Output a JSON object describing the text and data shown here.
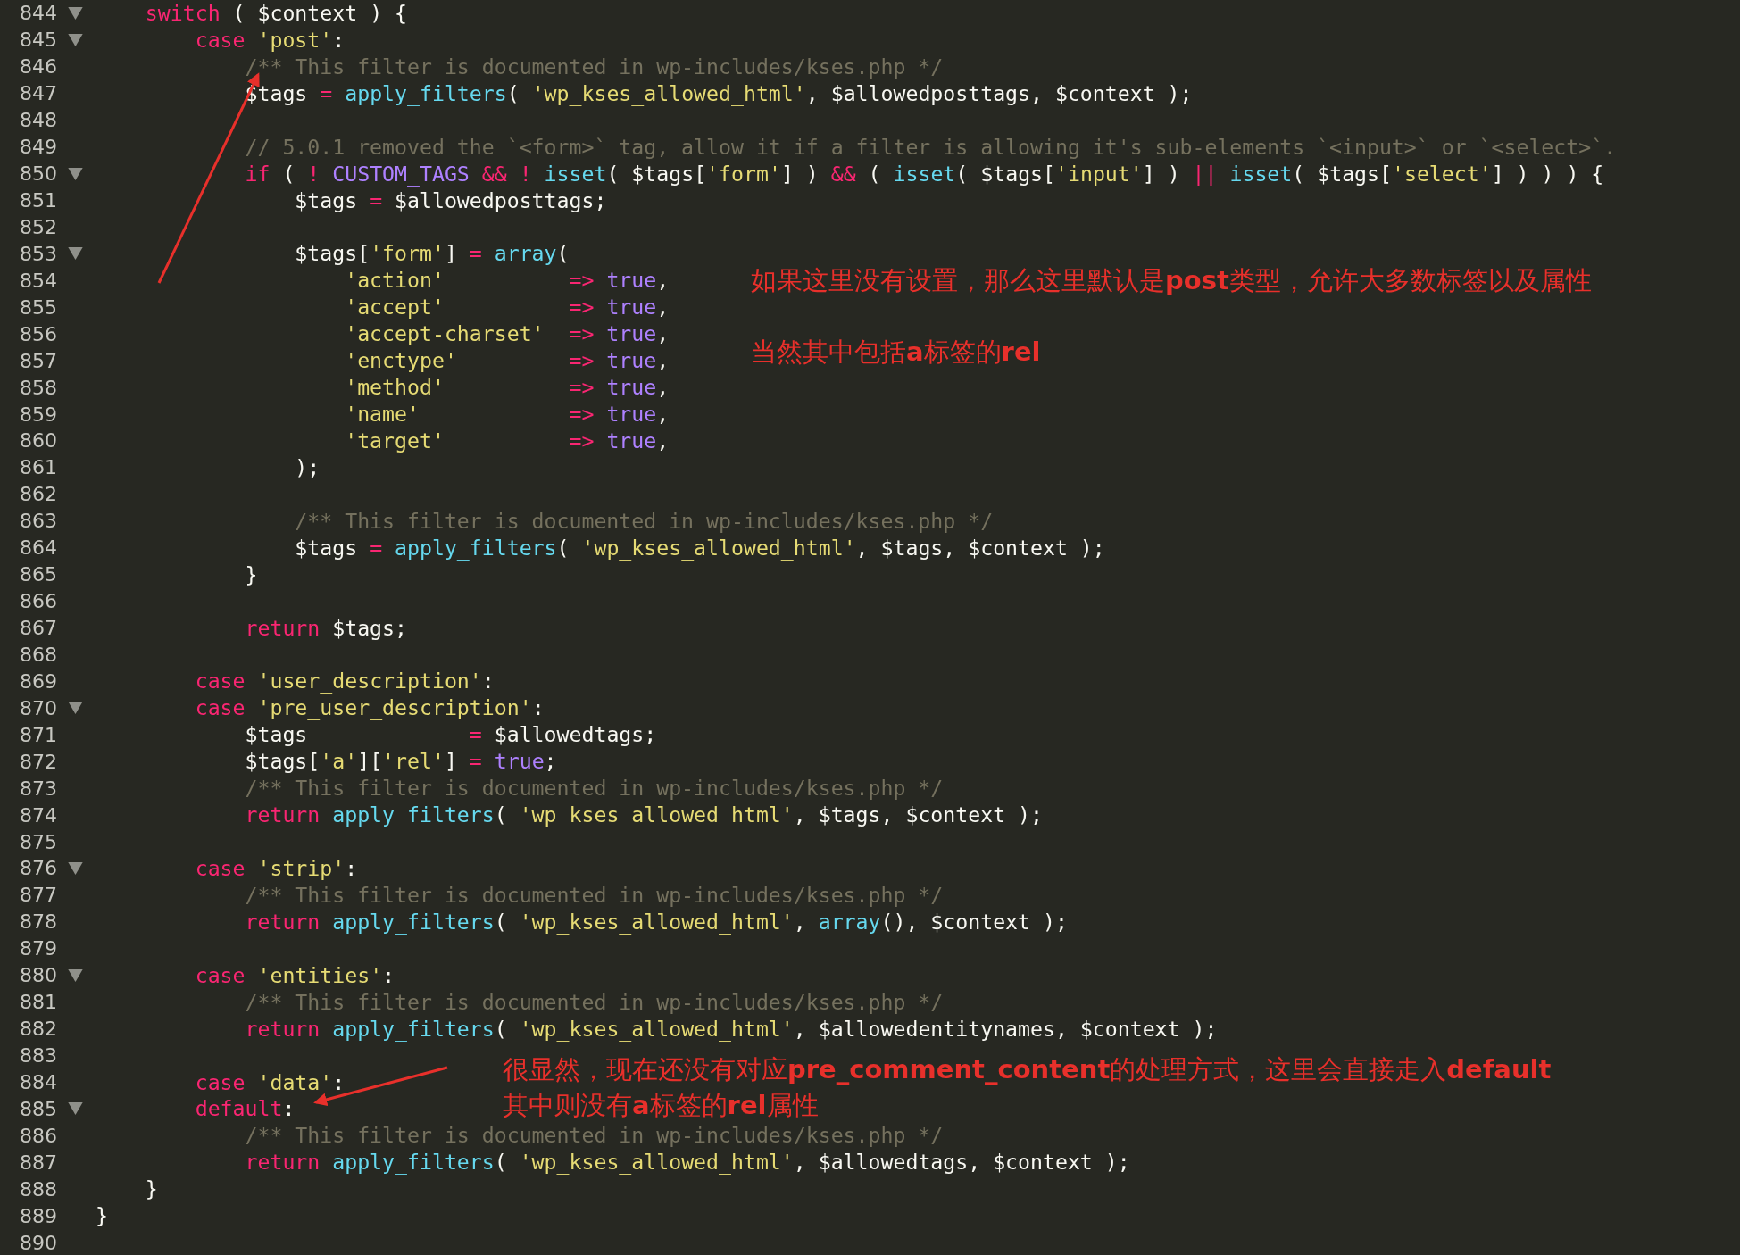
{
  "editor": {
    "lines": [
      {
        "num": "844",
        "fold": true,
        "tokens": [
          {
            "kind": "k",
            "text": "    switch"
          },
          {
            "kind": "p",
            "text": " ( $context ) {"
          }
        ]
      },
      {
        "num": "845",
        "fold": true,
        "tokens": [
          {
            "kind": "k",
            "text": "        case"
          },
          {
            "kind": "s",
            "text": " 'post'"
          },
          {
            "kind": "p",
            "text": ":"
          }
        ]
      },
      {
        "num": "846",
        "fold": false,
        "tokens": [
          {
            "kind": "c",
            "text": "            /** This filter is documented in wp-includes/kses.php */"
          }
        ]
      },
      {
        "num": "847",
        "fold": false,
        "tokens": [
          {
            "kind": "p",
            "text": "            $tags "
          },
          {
            "kind": "k",
            "text": "="
          },
          {
            "kind": "f",
            "text": " apply_filters"
          },
          {
            "kind": "p",
            "text": "( "
          },
          {
            "kind": "s",
            "text": "'wp_kses_allowed_html'"
          },
          {
            "kind": "p",
            "text": ", $allowedposttags, $context );"
          }
        ]
      },
      {
        "num": "848",
        "fold": false
      },
      {
        "num": "849",
        "fold": false,
        "tokens": [
          {
            "kind": "c",
            "text": "            // 5.0.1 removed the `<form>` tag, allow it if a filter is allowing it's sub-elements `<input>` or `<select>`."
          }
        ]
      },
      {
        "num": "850",
        "fold": true,
        "tokens": [
          {
            "kind": "k",
            "text": "            if"
          },
          {
            "kind": "p",
            "text": " ( "
          },
          {
            "kind": "k",
            "text": "!"
          },
          {
            "kind": "n",
            "text": " CUSTOM_TAGS"
          },
          {
            "kind": "k",
            "text": " &&"
          },
          {
            "kind": "k",
            "text": " !"
          },
          {
            "kind": "f",
            "text": " isset"
          },
          {
            "kind": "p",
            "text": "( $tags["
          },
          {
            "kind": "s",
            "text": "'form'"
          },
          {
            "kind": "p",
            "text": "] ) "
          },
          {
            "kind": "k",
            "text": "&&"
          },
          {
            "kind": "p",
            "text": " ( "
          },
          {
            "kind": "f",
            "text": "isset"
          },
          {
            "kind": "p",
            "text": "( $tags["
          },
          {
            "kind": "s",
            "text": "'input'"
          },
          {
            "kind": "p",
            "text": "] ) "
          },
          {
            "kind": "k",
            "text": "||"
          },
          {
            "kind": "f",
            "text": " isset"
          },
          {
            "kind": "p",
            "text": "( $tags["
          },
          {
            "kind": "s",
            "text": "'select'"
          },
          {
            "kind": "p",
            "text": "] ) ) ) {"
          }
        ]
      },
      {
        "num": "851",
        "fold": false,
        "tokens": [
          {
            "kind": "p",
            "text": "                $tags "
          },
          {
            "kind": "k",
            "text": "="
          },
          {
            "kind": "p",
            "text": " $allowedposttags;"
          }
        ]
      },
      {
        "num": "852",
        "fold": false
      },
      {
        "num": "853",
        "fold": true,
        "tokens": [
          {
            "kind": "p",
            "text": "                $tags["
          },
          {
            "kind": "s",
            "text": "'form'"
          },
          {
            "kind": "p",
            "text": "] "
          },
          {
            "kind": "k",
            "text": "="
          },
          {
            "kind": "f",
            "text": " array"
          },
          {
            "kind": "p",
            "text": "("
          }
        ]
      },
      {
        "num": "854",
        "fold": false,
        "tokens": [
          {
            "kind": "s",
            "text": "                    'action'"
          },
          {
            "kind": "k",
            "text": "          =>"
          },
          {
            "kind": "n",
            "text": " true"
          },
          {
            "kind": "p",
            "text": ","
          }
        ]
      },
      {
        "num": "855",
        "fold": false,
        "tokens": [
          {
            "kind": "s",
            "text": "                    'accept'"
          },
          {
            "kind": "k",
            "text": "          =>"
          },
          {
            "kind": "n",
            "text": " true"
          },
          {
            "kind": "p",
            "text": ","
          }
        ]
      },
      {
        "num": "856",
        "fold": false,
        "tokens": [
          {
            "kind": "s",
            "text": "                    'accept-charset'"
          },
          {
            "kind": "k",
            "text": "  =>"
          },
          {
            "kind": "n",
            "text": " true"
          },
          {
            "kind": "p",
            "text": ","
          }
        ]
      },
      {
        "num": "857",
        "fold": false,
        "tokens": [
          {
            "kind": "s",
            "text": "                    'enctype'"
          },
          {
            "kind": "k",
            "text": "         =>"
          },
          {
            "kind": "n",
            "text": " true"
          },
          {
            "kind": "p",
            "text": ","
          }
        ]
      },
      {
        "num": "858",
        "fold": false,
        "tokens": [
          {
            "kind": "s",
            "text": "                    'method'"
          },
          {
            "kind": "k",
            "text": "          =>"
          },
          {
            "kind": "n",
            "text": " true"
          },
          {
            "kind": "p",
            "text": ","
          }
        ]
      },
      {
        "num": "859",
        "fold": false,
        "tokens": [
          {
            "kind": "s",
            "text": "                    'name'"
          },
          {
            "kind": "k",
            "text": "            =>"
          },
          {
            "kind": "n",
            "text": " true"
          },
          {
            "kind": "p",
            "text": ","
          }
        ]
      },
      {
        "num": "860",
        "fold": false,
        "tokens": [
          {
            "kind": "s",
            "text": "                    'target'"
          },
          {
            "kind": "k",
            "text": "          =>"
          },
          {
            "kind": "n",
            "text": " true"
          },
          {
            "kind": "p",
            "text": ","
          }
        ]
      },
      {
        "num": "861",
        "fold": false,
        "tokens": [
          {
            "kind": "p",
            "text": "                );"
          }
        ]
      },
      {
        "num": "862",
        "fold": false
      },
      {
        "num": "863",
        "fold": false,
        "tokens": [
          {
            "kind": "c",
            "text": "                /** This filter is documented in wp-includes/kses.php */"
          }
        ]
      },
      {
        "num": "864",
        "fold": false,
        "tokens": [
          {
            "kind": "p",
            "text": "                $tags "
          },
          {
            "kind": "k",
            "text": "="
          },
          {
            "kind": "f",
            "text": " apply_filters"
          },
          {
            "kind": "p",
            "text": "( "
          },
          {
            "kind": "s",
            "text": "'wp_kses_allowed_html'"
          },
          {
            "kind": "p",
            "text": ", $tags, $context );"
          }
        ]
      },
      {
        "num": "865",
        "fold": false,
        "tokens": [
          {
            "kind": "p",
            "text": "            }"
          }
        ]
      },
      {
        "num": "866",
        "fold": false
      },
      {
        "num": "867",
        "fold": false,
        "tokens": [
          {
            "kind": "k",
            "text": "            return"
          },
          {
            "kind": "p",
            "text": " $tags;"
          }
        ]
      },
      {
        "num": "868",
        "fold": false
      },
      {
        "num": "869",
        "fold": false,
        "tokens": [
          {
            "kind": "k",
            "text": "        case"
          },
          {
            "kind": "s",
            "text": " 'user_description'"
          },
          {
            "kind": "p",
            "text": ":"
          }
        ]
      },
      {
        "num": "870",
        "fold": true,
        "tokens": [
          {
            "kind": "k",
            "text": "        case"
          },
          {
            "kind": "s",
            "text": " 'pre_user_description'"
          },
          {
            "kind": "p",
            "text": ":"
          }
        ]
      },
      {
        "num": "871",
        "fold": false,
        "tokens": [
          {
            "kind": "p",
            "text": "            $tags             "
          },
          {
            "kind": "k",
            "text": "="
          },
          {
            "kind": "p",
            "text": " $allowedtags;"
          }
        ]
      },
      {
        "num": "872",
        "fold": false,
        "tokens": [
          {
            "kind": "p",
            "text": "            $tags["
          },
          {
            "kind": "s",
            "text": "'a'"
          },
          {
            "kind": "p",
            "text": "]["
          },
          {
            "kind": "s",
            "text": "'rel'"
          },
          {
            "kind": "p",
            "text": "] "
          },
          {
            "kind": "k",
            "text": "="
          },
          {
            "kind": "n",
            "text": " true"
          },
          {
            "kind": "p",
            "text": ";"
          }
        ]
      },
      {
        "num": "873",
        "fold": false,
        "tokens": [
          {
            "kind": "c",
            "text": "            /** This filter is documented in wp-includes/kses.php */"
          }
        ]
      },
      {
        "num": "874",
        "fold": false,
        "tokens": [
          {
            "kind": "k",
            "text": "            return"
          },
          {
            "kind": "f",
            "text": " apply_filters"
          },
          {
            "kind": "p",
            "text": "( "
          },
          {
            "kind": "s",
            "text": "'wp_kses_allowed_html'"
          },
          {
            "kind": "p",
            "text": ", $tags, $context );"
          }
        ]
      },
      {
        "num": "875",
        "fold": false
      },
      {
        "num": "876",
        "fold": true,
        "tokens": [
          {
            "kind": "k",
            "text": "        case"
          },
          {
            "kind": "s",
            "text": " 'strip'"
          },
          {
            "kind": "p",
            "text": ":"
          }
        ]
      },
      {
        "num": "877",
        "fold": false,
        "tokens": [
          {
            "kind": "c",
            "text": "            /** This filter is documented in wp-includes/kses.php */"
          }
        ]
      },
      {
        "num": "878",
        "fold": false,
        "tokens": [
          {
            "kind": "k",
            "text": "            return"
          },
          {
            "kind": "f",
            "text": " apply_filters"
          },
          {
            "kind": "p",
            "text": "( "
          },
          {
            "kind": "s",
            "text": "'wp_kses_allowed_html'"
          },
          {
            "kind": "p",
            "text": ", "
          },
          {
            "kind": "f",
            "text": "array"
          },
          {
            "kind": "p",
            "text": "(), $context );"
          }
        ]
      },
      {
        "num": "879",
        "fold": false
      },
      {
        "num": "880",
        "fold": true,
        "tokens": [
          {
            "kind": "k",
            "text": "        case"
          },
          {
            "kind": "s",
            "text": " 'entities'"
          },
          {
            "kind": "p",
            "text": ":"
          }
        ]
      },
      {
        "num": "881",
        "fold": false,
        "tokens": [
          {
            "kind": "c",
            "text": "            /** This filter is documented in wp-includes/kses.php */"
          }
        ]
      },
      {
        "num": "882",
        "fold": false,
        "tokens": [
          {
            "kind": "k",
            "text": "            return"
          },
          {
            "kind": "f",
            "text": " apply_filters"
          },
          {
            "kind": "p",
            "text": "( "
          },
          {
            "kind": "s",
            "text": "'wp_kses_allowed_html'"
          },
          {
            "kind": "p",
            "text": ", $allowedentitynames, $context );"
          }
        ]
      },
      {
        "num": "883",
        "fold": false
      },
      {
        "num": "884",
        "fold": false,
        "tokens": [
          {
            "kind": "k",
            "text": "        case"
          },
          {
            "kind": "s",
            "text": " 'data'"
          },
          {
            "kind": "p",
            "text": ":"
          }
        ]
      },
      {
        "num": "885",
        "fold": true,
        "tokens": [
          {
            "kind": "k",
            "text": "        default"
          },
          {
            "kind": "p",
            "text": ":"
          }
        ]
      },
      {
        "num": "886",
        "fold": false,
        "tokens": [
          {
            "kind": "c",
            "text": "            /** This filter is documented in wp-includes/kses.php */"
          }
        ]
      },
      {
        "num": "887",
        "fold": false,
        "tokens": [
          {
            "kind": "k",
            "text": "            return"
          },
          {
            "kind": "f",
            "text": " apply_filters"
          },
          {
            "kind": "p",
            "text": "( "
          },
          {
            "kind": "s",
            "text": "'wp_kses_allowed_html'"
          },
          {
            "kind": "p",
            "text": ", $allowedtags, $context );"
          }
        ]
      },
      {
        "num": "888",
        "fold": false,
        "tokens": [
          {
            "kind": "p",
            "text": "    }"
          }
        ]
      },
      {
        "num": "889",
        "fold": false,
        "tokens": [
          {
            "kind": "p",
            "text": "}"
          }
        ]
      },
      {
        "num": "890",
        "fold": false
      }
    ]
  },
  "annotations": [
    {
      "kind": "top",
      "lines": [
        "如果这里没有设置，那么这里默认是**post**类型，允许大多数标签以及属性"
      ]
    },
    {
      "kind": "mid",
      "lines": [
        "当然其中包括**a**标签的**rel**"
      ]
    },
    {
      "kind": "bottom",
      "lines": [
        "很显然，现在还没有对应**pre_comment_content**的处理方式，这里会直接走入**default**",
        "其中则没有**a**标签的**rel**属性"
      ]
    }
  ]
}
